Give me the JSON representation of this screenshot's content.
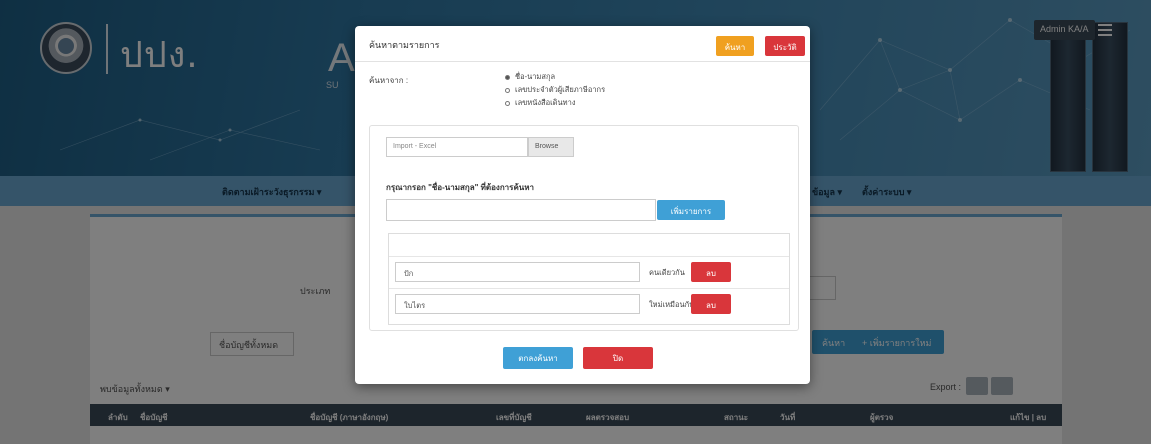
{
  "header": {
    "logo_text": "ปปง.",
    "brand_letter": "A",
    "brand_sub": "SU",
    "admin_label": "Admin KA/A"
  },
  "nav": {
    "items": [
      "ติดตามเฝ้าระวังธุรกรรม ▾",
      "ข้อมูล ▾",
      "ตั้งค่าระบบ ▾"
    ]
  },
  "background": {
    "filter_label": "ประเภท",
    "select_value": "ชื่อบัญชีทั้งหมด",
    "filter_select": "",
    "search_button": "ค้นหา",
    "add_button": "+ เพิ่มรายการใหม่",
    "count_label": "พบข้อมูลทั้งหมด ▾",
    "export_label": "Export :",
    "table_headers": [
      "ลำดับ",
      "ชื่อบัญชี",
      "ชื่อบัญชี (ภาษาอังกฤษ)",
      "เลขที่บัญชี",
      "ผลตรวจสอบ",
      "สถานะ",
      "วันที่",
      "ผู้ตรวจ",
      "แก้ไข | ลบ"
    ]
  },
  "modal": {
    "title": "ค้นหาตามรายการ",
    "btn_search": "ค้นหา",
    "btn_history": "ประวัติ",
    "type_label": "ค้นหาจาก :",
    "radio_options": [
      "ชื่อ-นามสกุล",
      "เลขประจำตัวผู้เสียภาษีอากร",
      "เลขหนังสือเดินทาง"
    ],
    "radio_selected": 0,
    "file_placeholder": "Import - Excel",
    "browse_label": "Browse",
    "instruction": "กรุณากรอก \"ชื่อ-นามสกุล\" ที่ต้องการค้นหา",
    "add_label": "เพิ่มรายการ",
    "rows": [
      {
        "value": "ปัก",
        "type": "คนเดียวกัน",
        "delete_label": "ลบออก"
      },
      {
        "value": "ใบไตร",
        "type": "ใหม่เหมือนกัน",
        "delete_label": "ลบออก"
      }
    ],
    "save_label": "ตกลงค้นหา",
    "close_label": "ปิด"
  },
  "colors": {
    "header": "#2f77a3",
    "nav": "#6aa9d2",
    "orange": "#f0a020",
    "red": "#d9363b",
    "blue": "#3fa0d6"
  }
}
